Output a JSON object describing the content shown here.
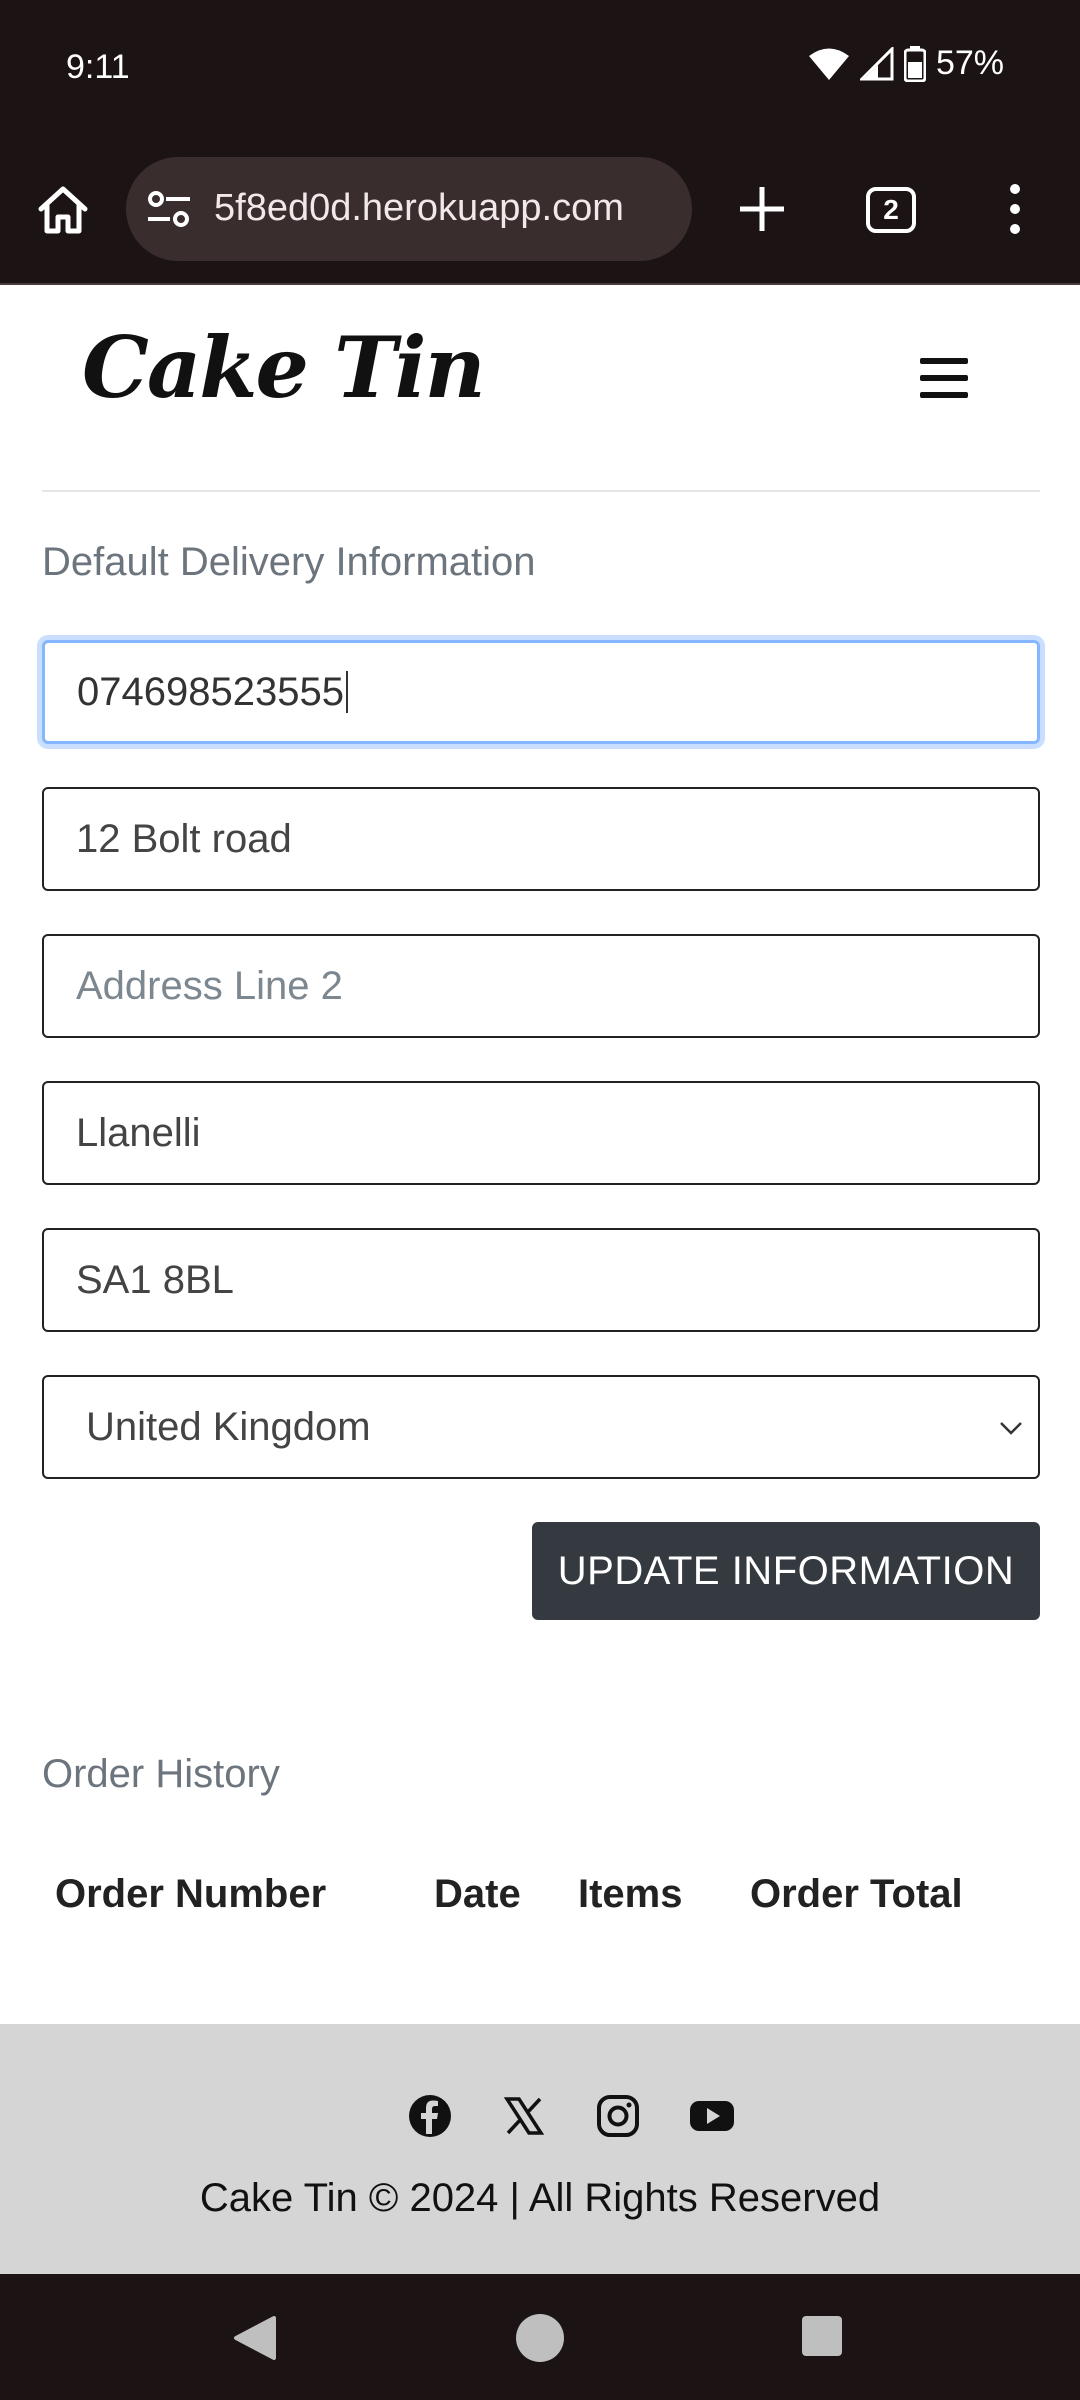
{
  "status_bar": {
    "time": "9:11",
    "battery": "57%"
  },
  "browser": {
    "url": "5f8ed0d.herokuapp.com",
    "tab_count": "2"
  },
  "site": {
    "logo": "Cake Tin"
  },
  "delivery": {
    "title": "Default Delivery Information",
    "phone": "074698523555",
    "address1": "12 Bolt road",
    "address2_placeholder": "Address Line 2",
    "town": "Llanelli",
    "postcode": "SA1 8BL",
    "country": "United Kingdom",
    "update_button": "UPDATE INFORMATION"
  },
  "orders": {
    "title": "Order History",
    "columns": [
      "Order Number",
      "Date",
      "Items",
      "Order Total"
    ]
  },
  "footer": {
    "social_icons": [
      "facebook-icon",
      "x-twitter-icon",
      "instagram-icon",
      "youtube-icon"
    ],
    "copyright": "Cake Tin © 2024 | All Rights Reserved"
  },
  "colors": {
    "bar": "#1c1314",
    "button": "#343a40",
    "focus": "#86b7fe",
    "footer": "#d5d5d5"
  }
}
